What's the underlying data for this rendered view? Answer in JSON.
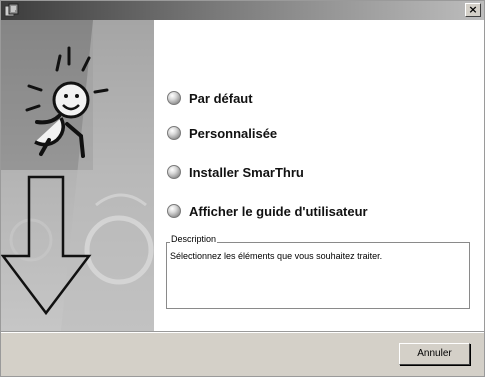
{
  "window": {
    "title": "",
    "close_glyph": "×",
    "app_icon": "installer-icon"
  },
  "sidepanel": {
    "mascot_icon": "running-figure-icon",
    "arrow_icon": "down-arrow-icon"
  },
  "menu": {
    "items": [
      {
        "label": "Par défaut",
        "icon": "radio-bullet-icon"
      },
      {
        "label": "Personnalisée",
        "icon": "radio-bullet-icon"
      },
      {
        "label": "Installer SmarThru",
        "icon": "radio-bullet-icon"
      },
      {
        "label": "Afficher le guide d'utilisateur",
        "icon": "radio-bullet-icon"
      }
    ]
  },
  "description": {
    "legend": "Description",
    "text": "Sélectionnez les éléments que vous souhaitez traiter."
  },
  "footer": {
    "cancel_label": "Annuler"
  },
  "colors": {
    "titlebar_start": "#3c3c3c",
    "titlebar_end": "#bdbdbd",
    "window_bg": "#d4d0c8",
    "sidepanel_bg": "#a9a9a9"
  }
}
